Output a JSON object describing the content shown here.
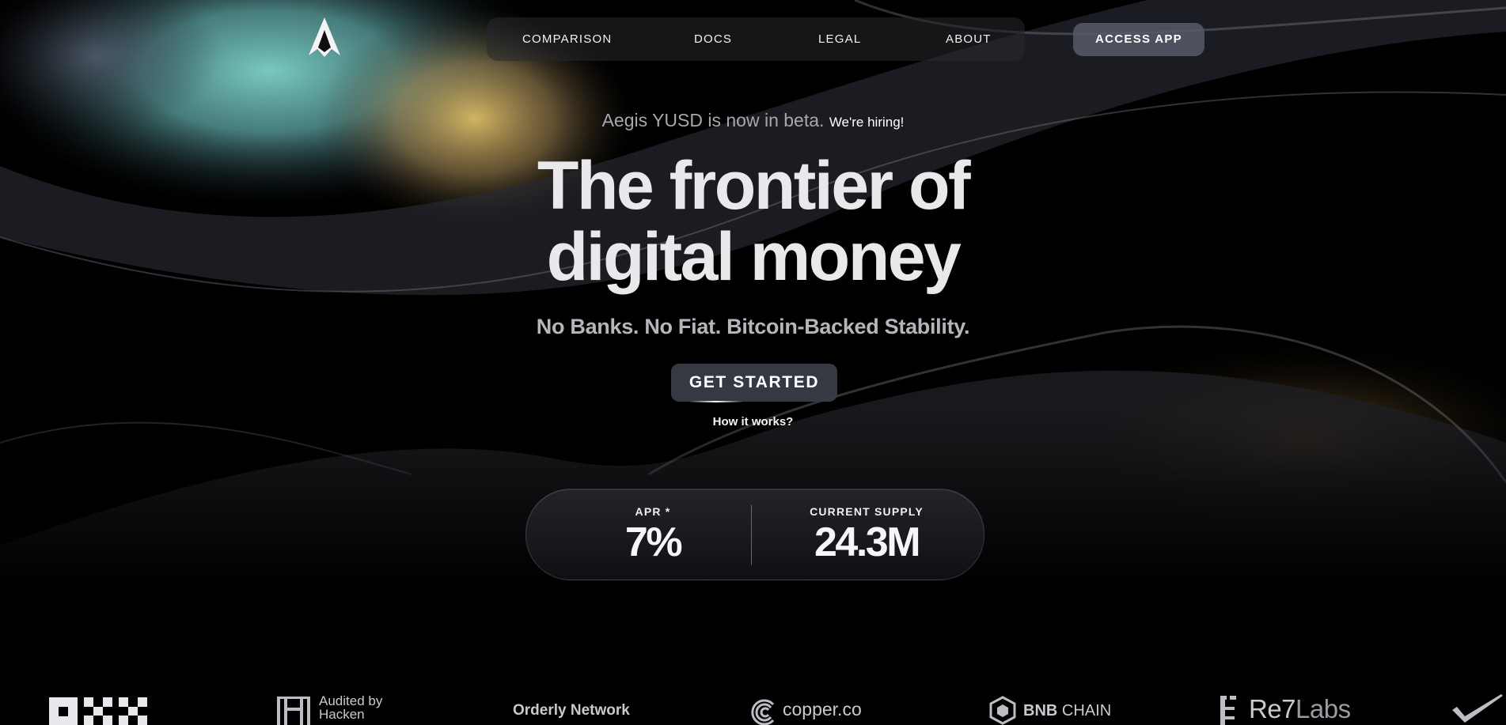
{
  "nav": {
    "items": [
      {
        "label": "COMPARISON"
      },
      {
        "label": "DOCS"
      },
      {
        "label": "LEGAL"
      },
      {
        "label": "ABOUT"
      }
    ],
    "access_label": "ACCESS APP"
  },
  "hero": {
    "beta_text": "Aegis YUSD is now in beta.",
    "hiring_link": "We're hiring!",
    "headline_line1": "The frontier of",
    "headline_line2": "digital money",
    "subheadline": "No Banks. No Fiat. Bitcoin-Backed Stability.",
    "cta_label": "GET STARTED",
    "how_link": "How it works?"
  },
  "stats": [
    {
      "label": "APR *",
      "value": "7%"
    },
    {
      "label": "CURRENT SUPPLY",
      "value": "24.3M"
    }
  ],
  "partners": {
    "hacken_line1": "Audited by",
    "hacken_line2": "Hacken",
    "orderly": "Orderly Network",
    "copper": "copper.co",
    "bnb_bold": "BNB",
    "bnb_rest": "CHAIN",
    "re7_a": "Re7",
    "re7_b": "Labs"
  }
}
